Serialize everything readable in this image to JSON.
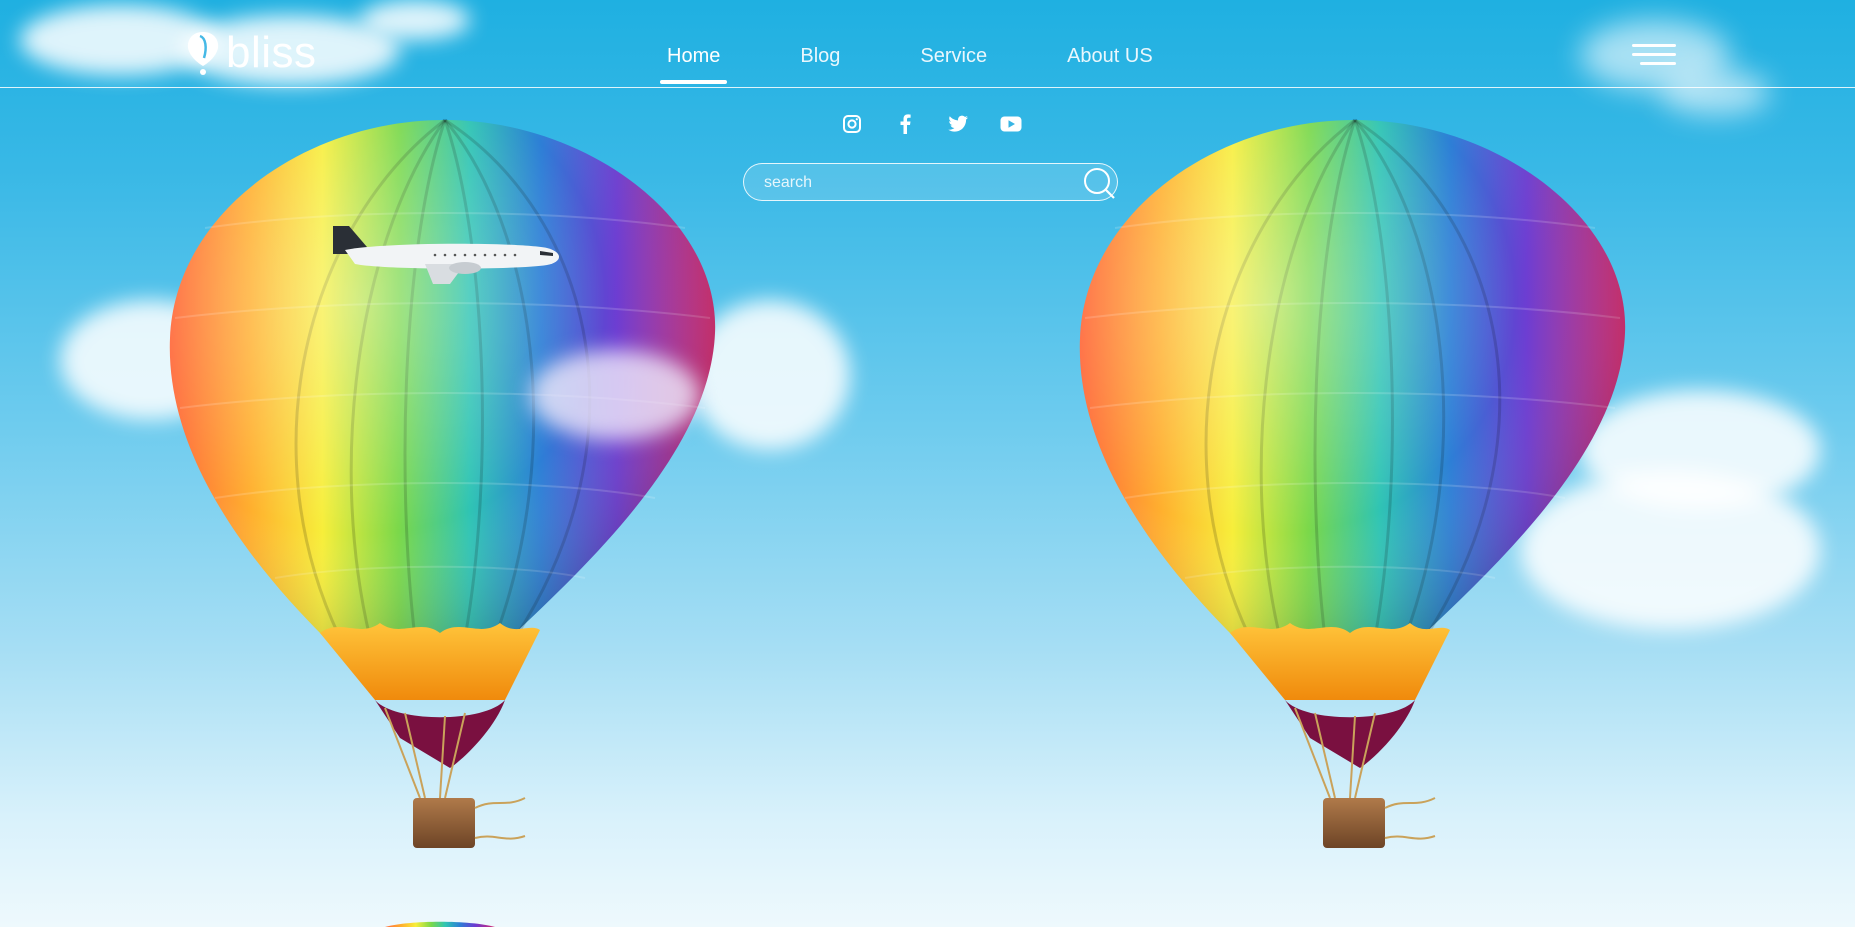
{
  "brand": {
    "name": "bliss"
  },
  "nav": {
    "items": [
      {
        "label": "Home",
        "active": true
      },
      {
        "label": "Blog",
        "active": false
      },
      {
        "label": "Service",
        "active": false
      },
      {
        "label": "About US",
        "active": false
      }
    ]
  },
  "social": [
    "instagram-icon",
    "facebook-icon",
    "twitter-icon",
    "youtube-icon"
  ],
  "search": {
    "placeholder": "search",
    "value": ""
  },
  "colors": {
    "sky_top": "#1fb0e1",
    "sky_bottom": "#eef9fd",
    "accent": "#ffffff",
    "basket": "#f5a31a"
  }
}
